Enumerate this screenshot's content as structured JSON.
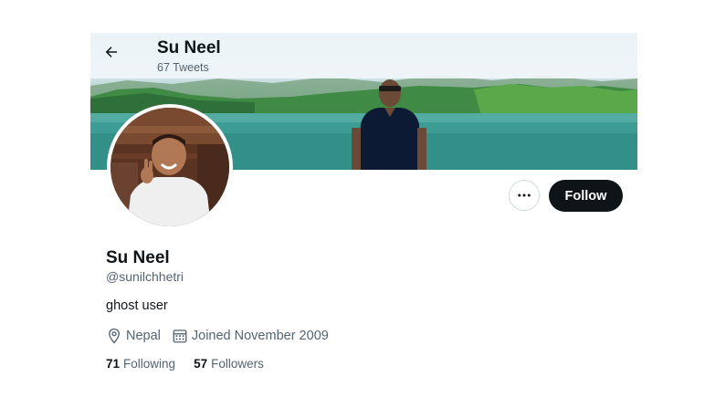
{
  "header": {
    "name": "Su Neel",
    "tweet_count": "67 Tweets",
    "back_icon": "arrow-left-icon"
  },
  "profile": {
    "display_name": "Su Neel",
    "handle": "@sunilchhetri",
    "bio": "ghost user",
    "location": "Nepal",
    "joined": "Joined November 2009",
    "location_icon": "location-pin-icon",
    "calendar_icon": "calendar-icon"
  },
  "actions": {
    "more_icon": "more-dots-icon",
    "follow_label": "Follow"
  },
  "stats": {
    "following_count": "71",
    "following_label": "Following",
    "followers_count": "57",
    "followers_label": "Followers"
  },
  "colors": {
    "text_primary": "#0f1419",
    "text_secondary": "#536471",
    "button_dark": "#0f1419",
    "border": "#cfd9de"
  }
}
